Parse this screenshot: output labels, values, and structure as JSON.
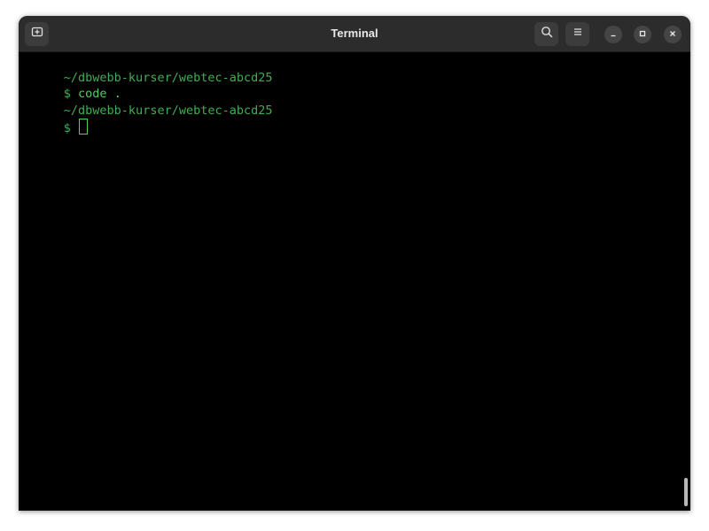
{
  "window": {
    "title": "Terminal"
  },
  "header": {
    "new_tab_icon": "new-tab-icon",
    "search_icon": "search-icon",
    "menu_icon": "hamburger-menu-icon",
    "minimize_icon": "minimize-icon",
    "maximize_icon": "maximize-icon",
    "close_icon": "close-icon"
  },
  "terminal": {
    "lines": [
      {
        "text": "~/dbwebb-kurser/webtec-abcd25"
      },
      {
        "prompt": "$",
        "command": " code ."
      },
      {
        "text": "~/dbwebb-kurser/webtec-abcd25"
      },
      {
        "prompt": "$",
        "command": " "
      }
    ]
  },
  "colors": {
    "background": "#000000",
    "titlebar": "#2c2c2c",
    "prompt_green": "#3fae52",
    "command_green": "#4bd25e"
  }
}
